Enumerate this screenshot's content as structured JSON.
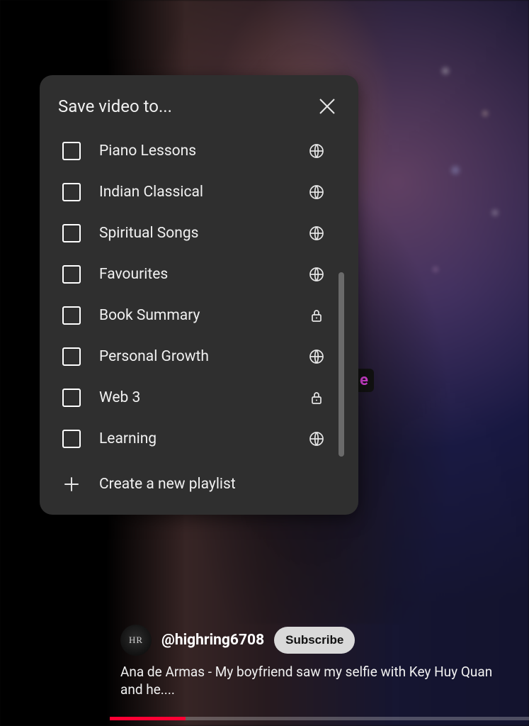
{
  "dialog": {
    "title": "Save video to...",
    "create_label": "Create a new playlist",
    "playlists": [
      {
        "name": "Piano Lessons",
        "privacy": "public"
      },
      {
        "name": "Indian Classical",
        "privacy": "public"
      },
      {
        "name": "Spiritual Songs",
        "privacy": "public"
      },
      {
        "name": "Favourites",
        "privacy": "public"
      },
      {
        "name": "Book Summary",
        "privacy": "private"
      },
      {
        "name": "Personal Growth",
        "privacy": "public"
      },
      {
        "name": "Web 3",
        "privacy": "private"
      },
      {
        "name": "Learning",
        "privacy": "public"
      }
    ]
  },
  "video": {
    "channel_handle": "@highring6708",
    "avatar_text": "HR",
    "subscribe_label": "Subscribe",
    "title": "Ana de Armas - My boyfriend saw my selfie with Key Huy Quan and he....",
    "caption_fragment": "e"
  }
}
